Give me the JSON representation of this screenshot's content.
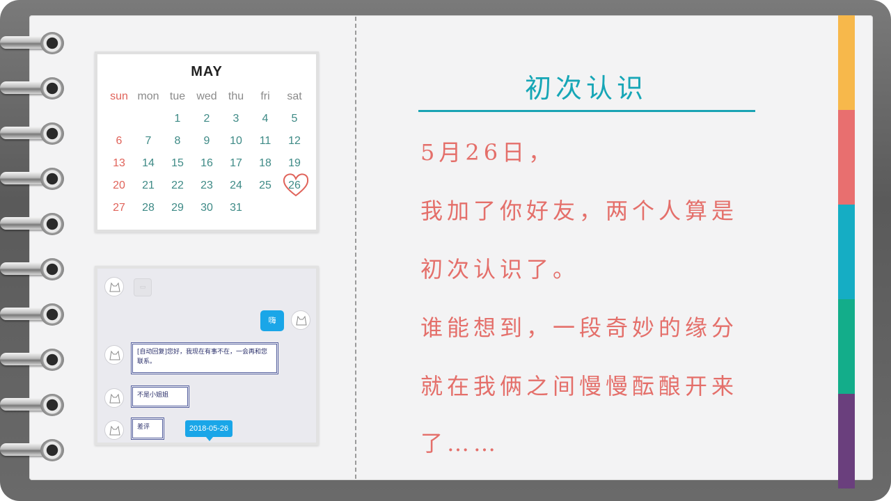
{
  "calendar": {
    "month": "MAY",
    "weekdays": [
      "sun",
      "mon",
      "tue",
      "wed",
      "thu",
      "fri",
      "sat"
    ],
    "weeks": [
      [
        "",
        "",
        "1",
        "2",
        "3",
        "4",
        "5"
      ],
      [
        "6",
        "7",
        "8",
        "9",
        "10",
        "11",
        "12"
      ],
      [
        "13",
        "14",
        "15",
        "16",
        "17",
        "18",
        "19"
      ],
      [
        "20",
        "21",
        "22",
        "23",
        "24",
        "25",
        "26"
      ],
      [
        "27",
        "28",
        "29",
        "30",
        "31",
        "",
        ""
      ]
    ],
    "highlighted_day": "26",
    "colors": {
      "weekday": "#3e8a86",
      "sunday": "#e0635a",
      "heart": "#e0635a"
    }
  },
  "chat": {
    "sent_message": "嗨",
    "replies": [
      "[自动回复]您好，我现在有事不在，一会再和您联系。",
      "不是小姐姐",
      "差评"
    ],
    "timestamp": "2018-05-26"
  },
  "page": {
    "title": "初次认识",
    "lines": [
      "5月26日，",
      "我加了你好友，两个人算是",
      "初次认识了。",
      "谁能想到，一段奇妙的缘分",
      "就在我俩之间慢慢酝酿开来",
      "了……"
    ],
    "colors": {
      "title": "#16a6b6",
      "text": "#e46f6a"
    }
  },
  "tabs": {
    "colors": [
      "#f7b84b",
      "#e86f6f",
      "#15adc4",
      "#13ad8a",
      "#6a3f7d"
    ]
  },
  "icons": {
    "ring": "spiral-binding-ring-icon",
    "heart": "heart-outline-icon",
    "avatar": "cat-avatar-icon"
  }
}
